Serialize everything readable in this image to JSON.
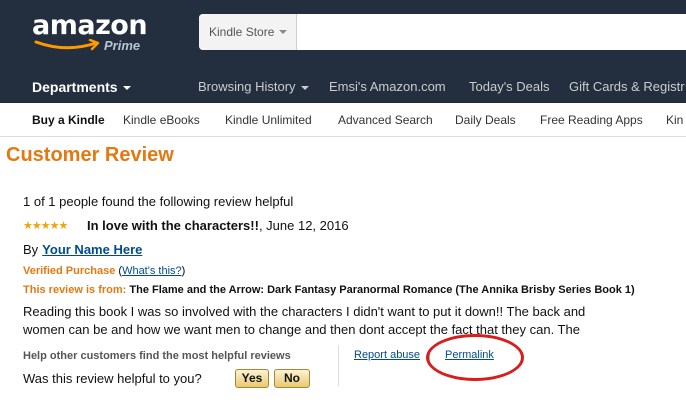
{
  "header": {
    "logo_text": "amazon",
    "logo_sub": "Prime",
    "search": {
      "category": "Kindle Store",
      "value": ""
    },
    "departments_label": "Departments",
    "nav_links": [
      {
        "label": "Browsing History",
        "has_caret": true
      },
      {
        "label": "Emsi's Amazon.com",
        "has_caret": false
      },
      {
        "label": "Today's Deals",
        "has_caret": false
      },
      {
        "label": "Gift Cards & Registr",
        "has_caret": false
      }
    ]
  },
  "subnav": {
    "items": [
      "Buy a Kindle",
      "Kindle eBooks",
      "Kindle Unlimited",
      "Advanced Search",
      "Daily Deals",
      "Free Reading Apps",
      "Kin"
    ]
  },
  "review": {
    "page_title": "Customer Review",
    "helpful_count": "1 of 1 people found the following review helpful",
    "rating": 5,
    "title": "In love with the characters!!",
    "date": ", June 12, 2016",
    "by_label": "By",
    "author": "Your Name Here",
    "verified_label": "Verified Purchase",
    "whats_this": "What's this?",
    "from_label": "This review is from:",
    "book_title": "The Flame and the Arrow: Dark Fantasy Paranormal Romance (The Annika Brisby Series Book 1)",
    "body_lines": [
      "Reading this book I was so involved with the characters I didn't want to put it down!! The back and",
      "women can be and how we want men to change and then dont accept the fact that they can. The"
    ],
    "help_others": "Help other customers find the most helpful reviews",
    "was_helpful": "Was this review helpful to you?",
    "yes_label": "Yes",
    "no_label": "No",
    "report_abuse": "Report abuse",
    "permalink": "Permalink"
  },
  "colors": {
    "header_bg": "#232f3e",
    "title_orange": "#e47911",
    "link_blue": "#004b91",
    "annotation_red": "#d91c1c"
  }
}
